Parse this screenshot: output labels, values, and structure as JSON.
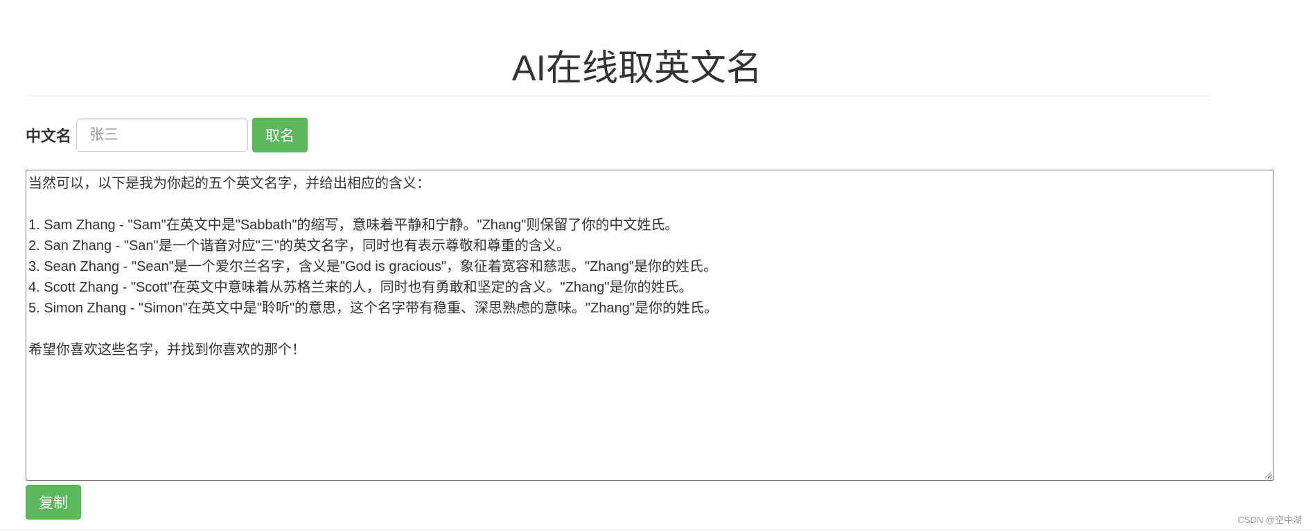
{
  "header": {
    "title": "AI在线取英文名"
  },
  "form": {
    "label": "中文名",
    "input_placeholder": "张三",
    "submit_label": "取名"
  },
  "result": {
    "lines": [
      "当然可以，以下是我为你起的五个英文名字，并给出相应的含义：",
      "",
      "1. Sam Zhang - \"Sam\"在英文中是\"Sabbath\"的缩写，意味着平静和宁静。\"Zhang\"则保留了你的中文姓氏。",
      "2. San Zhang - \"San\"是一个谐音对应\"三\"的英文名字，同时也有表示尊敬和尊重的含义。",
      "3. Sean Zhang - \"Sean\"是一个爱尔兰名字，含义是\"God is gracious\"，象征着宽容和慈悲。\"Zhang\"是你的姓氏。",
      "4. Scott Zhang - \"Scott\"在英文中意味着从苏格兰来的人，同时也有勇敢和坚定的含义。\"Zhang\"是你的姓氏。",
      "5. Simon Zhang - \"Simon\"在英文中是\"聆听\"的意思，这个名字带有稳重、深思熟虑的意味。\"Zhang\"是你的姓氏。",
      "",
      "希望你喜欢这些名字，并找到你喜欢的那个！"
    ]
  },
  "actions": {
    "copy_label": "复制"
  },
  "watermark": "CSDN @空中湖",
  "colors": {
    "button_green": "#5cb85c",
    "button_green_border": "#4cae4c",
    "text": "#333333"
  }
}
